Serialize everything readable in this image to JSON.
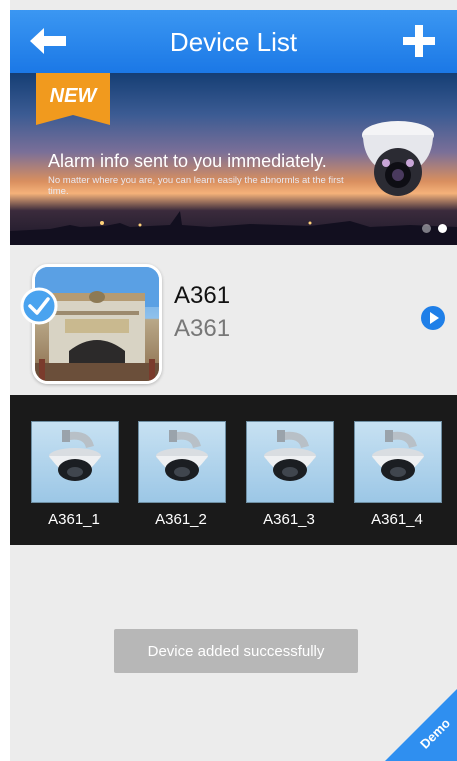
{
  "header": {
    "title": "Device List",
    "back_icon": "back-arrow-icon",
    "add_icon": "plus-icon"
  },
  "banner": {
    "badge": "NEW",
    "headline": "Alarm info sent to you immediately.",
    "subline": "No matter where you are, you can learn easily the abnormls at the first time.",
    "carousel_dots": 2,
    "active_dot": 2
  },
  "device": {
    "name": "A361",
    "subtitle": "A361",
    "selected": true,
    "play_icon": "play-circle-icon"
  },
  "channels": [
    {
      "label": "A361_1",
      "icon": "dome-camera-icon"
    },
    {
      "label": "A361_2",
      "icon": "dome-camera-icon"
    },
    {
      "label": "A361_3",
      "icon": "dome-camera-icon"
    },
    {
      "label": "A361_4",
      "icon": "dome-camera-icon"
    }
  ],
  "toast": {
    "message": "Device added successfully"
  },
  "corner_badge": {
    "label": "Demo"
  },
  "colors": {
    "header": "#1f7ee8",
    "accent": "#2f8ff0",
    "badge": "#f19a1e",
    "channel_strip": "#1a1a1a"
  }
}
